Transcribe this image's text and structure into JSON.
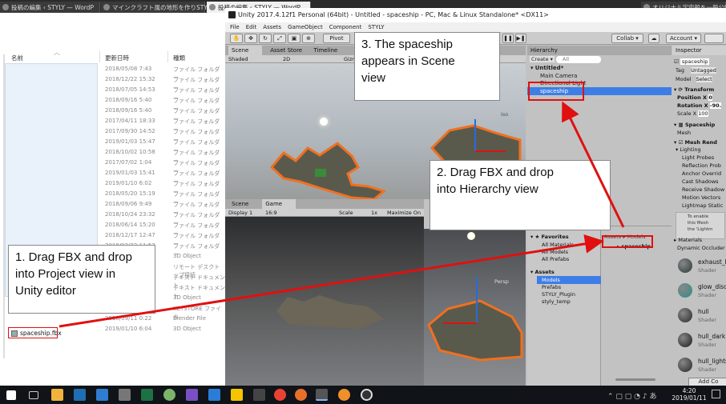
{
  "browser_tabs": [
    {
      "label": "投稿の編集 ‹ STYLY — WordP"
    },
    {
      "label": "マインクラフト風の地形を作りSTYLY"
    },
    {
      "label": "投稿の編集 ‹ STYLY — WordP"
    },
    {
      "label": "オリジナル宇宙船を一般公開させ"
    }
  ],
  "explorer": {
    "columns": [
      "名前",
      "更新日時",
      "種類"
    ],
    "rows": [
      {
        "date": "2018/05/08 7:43",
        "type": "ファイル フォルダー"
      },
      {
        "date": "2018/12/22 15:32",
        "type": "ファイル フォルダー"
      },
      {
        "date": "2018/07/05 14:53",
        "type": "ファイル フォルダー"
      },
      {
        "date": "2018/09/16 5:40",
        "type": "ファイル フォルダー"
      },
      {
        "date": "2018/09/16 5:40",
        "type": "ファイル フォルダー"
      },
      {
        "date": "2017/04/11 18:33",
        "type": "ファイル フォルダー"
      },
      {
        "date": "2017/09/30 14:52",
        "type": "ファイル フォルダー"
      },
      {
        "date": "2019/01/03 15:47",
        "type": "ファイル フォルダー"
      },
      {
        "date": "2018/10/02 10:58",
        "type": "ファイル フォルダー"
      },
      {
        "date": "2017/07/02 1:04",
        "type": "ファイル フォルダー"
      },
      {
        "date": "2019/01/03 15:41",
        "type": "ファイル フォルダー"
      },
      {
        "date": "2019/01/10 6:02",
        "type": "ファイル フォルダー"
      },
      {
        "date": "2018/05/20 15:19",
        "type": "ファイル フォルダー"
      },
      {
        "date": "2018/09/06 9:49",
        "type": "ファイル フォルダー"
      },
      {
        "date": "2018/10/24 23:32",
        "type": "ファイル フォルダー"
      },
      {
        "date": "2018/06/14 15:20",
        "type": "ファイル フォルダー"
      },
      {
        "date": "2018/12/17 12:47",
        "type": "ファイル フォルダー"
      },
      {
        "date": "2018/02/22 11:53",
        "type": "ファイル フォルダー"
      },
      {
        "date": "",
        "type": "3D Object"
      },
      {
        "date": "",
        "type": "リモート デスクトップ接続"
      },
      {
        "date": "",
        "type": "テキスト ドキュメント"
      },
      {
        "date": "",
        "type": "テキスト ドキュメント"
      },
      {
        "date": "",
        "type": "3D Object"
      },
      {
        "date": "",
        "type": "KEYSTORE ファイル"
      },
      {
        "date": "2018/09/11 0:22",
        "type": "Blender File"
      },
      {
        "date": "2019/01/10 6:04",
        "type": "3D Object"
      }
    ],
    "selected_file": "spaceship.fbx"
  },
  "unity": {
    "title": "Unity 2017.4.12f1 Personal (64bit) - Untitled - spaceship - PC, Mac & Linux Standalone* <DX11>",
    "menu": [
      "File",
      "Edit",
      "Assets",
      "GameObject",
      "Component",
      "STYLY"
    ],
    "toolbar": {
      "pivot": "Pivot",
      "collab": "Collab ▾",
      "account": "Account ▾"
    },
    "scene_tabs": [
      "Scene",
      "Asset Store",
      "Timeline"
    ],
    "scene_bar": {
      "shading": "Shaded",
      "mode": "2D",
      "gizmos": "Gizmos"
    },
    "persp_label": "Iso",
    "persp_label_2": "Persp",
    "game_tabs": [
      "Scene",
      "Game"
    ],
    "game_bar": {
      "display": "Display 1",
      "aspect": "16:9",
      "scale": "Scale",
      "scale_val": "1x",
      "max": "Maximize On P"
    },
    "hierarchy": {
      "tab": "Hierarchy",
      "create": "Create ▾",
      "search": "All",
      "scene": "Untitled*",
      "items": [
        "Main Camera",
        "Directional Light",
        "spaceship"
      ]
    },
    "project": {
      "favorites": "Favorites",
      "fav_items": [
        "All Materials",
        "All Models",
        "All Prefabs"
      ],
      "assets": "Assets",
      "asset_items": [
        "Models",
        "Prefabs",
        "STYLY_Plugin",
        "styly_temp"
      ],
      "breadcrumb": "Assets ▸ Models",
      "model_file": "spaceship"
    },
    "inspector": {
      "tab": "Inspector",
      "object_name": "spaceship",
      "tag_label": "Tag",
      "tag_value": "Untagged",
      "model_label": "Model",
      "select_btn": "Select",
      "transform": "Transform",
      "position": {
        "label": "Position",
        "x": "X",
        "xval": "0"
      },
      "rotation": {
        "label": "Rotation",
        "x": "X",
        "xval": "-90."
      },
      "scale": {
        "label": "Scale",
        "x": "X",
        "xval": "100"
      },
      "mesh_filter": "Spaceship",
      "mesh_label": "Mesh",
      "mesh_renderer": "Mesh Rend",
      "lighting": "Lighting",
      "props": [
        "Light Probes",
        "Reflection Prob",
        "Anchor Overrid",
        "Cast Shadows",
        "Receive Shadow",
        "Motion Vectors",
        "Lightmap Static"
      ],
      "note": [
        "To enable",
        "this Mesh",
        "the 'Lightm"
      ],
      "materials": "Materials",
      "dyn_occ": "Dynamic Occluder",
      "mats": [
        {
          "name": "exhaust_l",
          "shader": "Shader",
          "color": "#2a3a3a"
        },
        {
          "name": "glow_disc",
          "shader": "Shader",
          "color": "#2e8c86"
        },
        {
          "name": "hull",
          "shader": "Shader",
          "color": "#2a2a2a"
        },
        {
          "name": "hull_dark",
          "shader": "Shader",
          "color": "#1a1a1a"
        },
        {
          "name": "hull_lights",
          "shader": "Shader",
          "color": "#262626"
        }
      ],
      "add_component": "Add Co"
    }
  },
  "callouts": {
    "step1": [
      "1. Drag FBX and drop",
      "into Project view in",
      "Unity editor"
    ],
    "step2": [
      "2. Drag FBX and drop",
      "into Hierarchy view"
    ],
    "step3": [
      "3. The spaceship",
      "appears in Scene",
      "view"
    ]
  },
  "taskbar": {
    "time": "4:20",
    "date": "2019/01/11"
  },
  "colors": {
    "highlight": "#e01010",
    "selection": "#3d7ee6",
    "scene_orange": "#f07020"
  }
}
